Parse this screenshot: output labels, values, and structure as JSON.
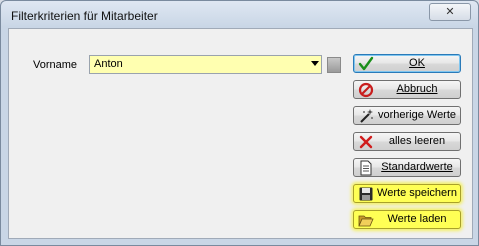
{
  "window": {
    "title": "Filterkriterien für Mitarbeiter",
    "close_glyph": "✕"
  },
  "form": {
    "vorname_label": "Vorname",
    "vorname_value": "Anton"
  },
  "buttons": {
    "ok": "OK",
    "abbruch": "Abbruch",
    "vorherige": "vorherige Werte",
    "leeren": "alles leeren",
    "standard": "Standardwerte",
    "speichern": "Werte speichern",
    "laden": "Werte laden"
  },
  "colors": {
    "highlight": "#ffff55",
    "combo_bg": "#ffffb0",
    "ok_check": "#1a8f1a",
    "abbruch_red": "#c81e1e"
  }
}
